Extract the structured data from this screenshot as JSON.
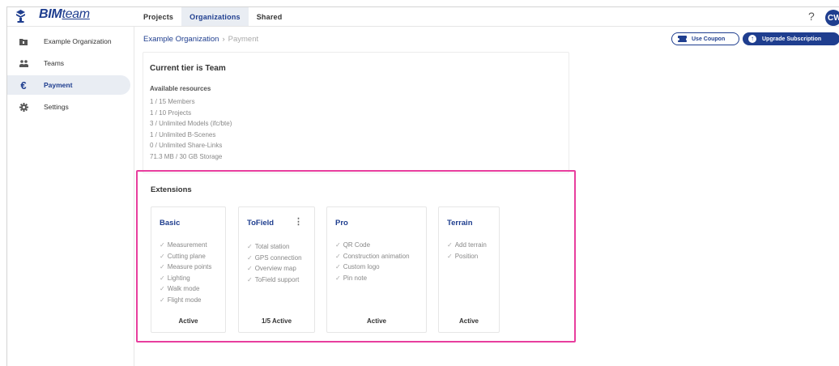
{
  "app": {
    "logo_bim": "BIM",
    "logo_team": "team"
  },
  "topnav": {
    "tabs": [
      {
        "label": "Projects",
        "active": false
      },
      {
        "label": "Organizations",
        "active": true
      },
      {
        "label": "Shared",
        "active": false
      }
    ],
    "help": "?",
    "avatar_initials": "CW"
  },
  "sidebar": {
    "items": [
      {
        "label": "Example Organization",
        "icon": "folder-icon",
        "active": false
      },
      {
        "label": "Teams",
        "icon": "people-icon",
        "active": false
      },
      {
        "label": "Payment",
        "icon": "euro-icon",
        "active": true
      },
      {
        "label": "Settings",
        "icon": "gear-icon",
        "active": false
      }
    ]
  },
  "breadcrumb": {
    "org": "Example Organization",
    "separator": "›",
    "current": "Payment"
  },
  "actions": {
    "coupon": "Use Coupon",
    "upgrade": "Upgrade Subscription"
  },
  "tier": {
    "title": "Current tier is Team",
    "resources_heading": "Available resources",
    "resources": [
      "1 / 15 Members",
      "1 / 10 Projects",
      "3 / Unlimited Models (ifc/bte)",
      "1 / Unlimited B-Scenes",
      "0 / Unlimited Share-Links",
      "71.3 MB / 30 GB Storage"
    ]
  },
  "extensions": {
    "title": "Extensions",
    "cards": [
      {
        "name": "Basic",
        "features": [
          "Measurement",
          "Cutting plane",
          "Measure points",
          "Lighting",
          "Walk mode",
          "Flight mode"
        ],
        "status": "Active",
        "has_menu": false
      },
      {
        "name": "ToField",
        "features": [
          "Total station",
          "GPS connection",
          "Overview map",
          "ToField support"
        ],
        "status": "1/5 Active",
        "has_menu": true
      },
      {
        "name": "Pro",
        "features": [
          "QR Code",
          "Construction animation",
          "Custom logo",
          "Pin note"
        ],
        "status": "Active",
        "has_menu": false
      },
      {
        "name": "Terrain",
        "features": [
          "Add terrain",
          "Position"
        ],
        "status": "Active",
        "has_menu": false
      }
    ]
  },
  "colors": {
    "brand": "#1f3e8f",
    "highlight": "#e83e9e",
    "active_bg": "#e9edf3"
  }
}
